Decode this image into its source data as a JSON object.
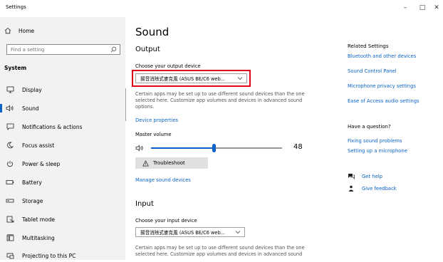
{
  "window": {
    "title": "Settings",
    "minimize": "–",
    "maximize": "□",
    "close": "✕"
  },
  "sidebar": {
    "home_label": "Home",
    "search_placeholder": "Find a setting",
    "section_title": "System",
    "items": [
      {
        "label": "Display",
        "icon": "monitor-icon"
      },
      {
        "label": "Sound",
        "icon": "speaker-icon",
        "selected": true
      },
      {
        "label": "Notifications & actions",
        "icon": "notification-icon"
      },
      {
        "label": "Focus assist",
        "icon": "moon-icon"
      },
      {
        "label": "Power & sleep",
        "icon": "power-icon"
      },
      {
        "label": "Battery",
        "icon": "battery-icon"
      },
      {
        "label": "Storage",
        "icon": "storage-icon"
      },
      {
        "label": "Tablet mode",
        "icon": "tablet-icon"
      },
      {
        "label": "Multitasking",
        "icon": "multitasking-icon"
      },
      {
        "label": "Projecting to this PC",
        "icon": "projector-icon"
      }
    ]
  },
  "main": {
    "title": "Sound",
    "output": {
      "heading": "Output",
      "device_label": "Choose your output device",
      "device_value": "揚音消除式麥克風 (ASUS BE/C6 web...",
      "description": "Certain apps may be set up to use different sound devices than the one selected here. Customize app volumes and devices in advanced sound options.",
      "device_properties_link": "Device properties",
      "volume_label": "Master volume",
      "volume_value": "48",
      "volume_percent": 48,
      "troubleshoot_label": "Troubleshoot",
      "manage_link": "Manage sound devices"
    },
    "input": {
      "heading": "Input",
      "device_label": "Choose your input device",
      "device_value": "揚音消除式麥克風 (ASUS BE/C6 web...",
      "description": "Certain apps may be set up to use different sound devices than the one selected here. Customize app volumes and devices in advanced sound"
    }
  },
  "related": {
    "title": "Related Settings",
    "links": [
      "Bluetooth and other devices",
      "Sound Control Panel",
      "Microphone privacy settings",
      "Ease of Access audio settings"
    ],
    "question_title": "Have a question?",
    "question_links": [
      "Fixing sound problems",
      "Setting up a microphone"
    ],
    "get_help": "Get help",
    "give_feedback": "Give feedback"
  },
  "colors": {
    "accent": "#0a64c8",
    "highlight": "#e0001a",
    "sidebar_bg": "#f2f2f2"
  }
}
